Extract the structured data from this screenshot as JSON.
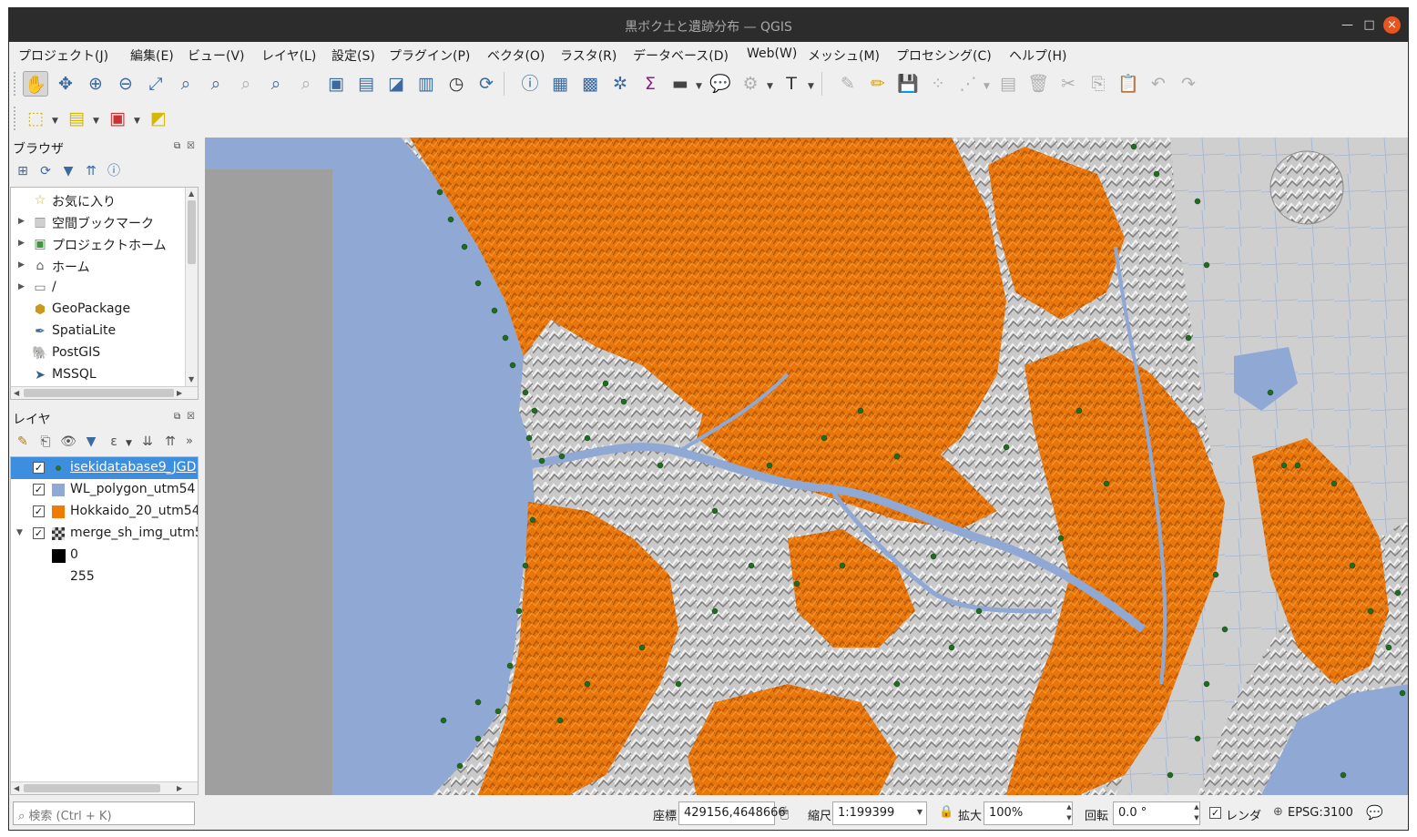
{
  "window": {
    "title": "黒ボク土と遺跡分布 — QGIS"
  },
  "menu": [
    "プロジェクト(J)",
    "編集(E)",
    "ビュー(V)",
    "レイヤ(L)",
    "設定(S)",
    "プラグイン(P)",
    "ベクタ(O)",
    "ラスタ(R)",
    "データベース(D)",
    "Web(W)",
    "メッシュ(M)",
    "プロセシング(C)",
    "ヘルプ(H)"
  ],
  "toolbar1_icons": [
    "pan-icon",
    "pan-to-selection-icon",
    "zoom-in-icon",
    "zoom-out-icon",
    "zoom-full-icon",
    "zoom-to-selection-icon",
    "zoom-to-layer-icon",
    "zoom-native-icon",
    "zoom-last-icon",
    "zoom-next-icon",
    "new-bookmark-icon",
    "show-bookmarks-icon",
    "new-map-view-icon",
    "new-3d-view-icon",
    "temporal-controller-icon",
    "refresh-icon",
    "identify-icon",
    "attribute-table-icon",
    "field-calculator-icon",
    "statistics-icon",
    "sigma-icon",
    "measure-icon",
    "map-tips-icon",
    "locator-icon",
    "text-annotation-icon",
    "digitize-icon",
    "edit-pencil-icon",
    "save-edits-icon",
    "add-feature-icon",
    "vertex-tool-icon",
    "modify-attributes-icon",
    "delete-selected-icon",
    "cut-features-icon",
    "copy-features-icon",
    "paste-features-icon",
    "undo-icon",
    "redo-icon"
  ],
  "toolbar2_icons": [
    "select-features-icon",
    "select-by-value-icon",
    "deselect-all-icon",
    "select-location-icon"
  ],
  "browser": {
    "title": "ブラウザ",
    "items": [
      {
        "label": "お気に入り",
        "icon": "star-icon"
      },
      {
        "label": "空間ブックマーク",
        "icon": "bookmark-icon"
      },
      {
        "label": "プロジェクトホーム",
        "icon": "project-home-icon"
      },
      {
        "label": "ホーム",
        "icon": "home-icon"
      },
      {
        "label": "/",
        "icon": "folder-icon"
      },
      {
        "label": "GeoPackage",
        "icon": "geopackage-icon"
      },
      {
        "label": "SpatiaLite",
        "icon": "spatialite-icon"
      },
      {
        "label": "PostGIS",
        "icon": "postgis-icon"
      },
      {
        "label": "MSSQL",
        "icon": "mssql-icon"
      }
    ]
  },
  "layers": {
    "title": "レイヤ",
    "items": [
      {
        "label": "isekidatabase9_JGD",
        "selected": true,
        "color": "#2e6b2e"
      },
      {
        "label": "WL_polygon_utm54",
        "selected": false,
        "color": "#8fa8d4"
      },
      {
        "label": "Hokkaido_20_utm54",
        "selected": false,
        "color": "#f07b00"
      },
      {
        "label": "merge_sh_img_utm5",
        "selected": false,
        "color": "#808080"
      }
    ],
    "legend": [
      "0",
      "255"
    ]
  },
  "status": {
    "search_placeholder": "検索 (Ctrl + K)",
    "coord_label": "座標",
    "coord_value": "429156,4648666",
    "scale_label": "縮尺",
    "scale_value": "1:199399",
    "magnifier_label": "拡大",
    "magnifier_value": "100%",
    "rotation_label": "回転",
    "rotation_value": "0.0 °",
    "render_label": "レンダ",
    "crs": "EPSG:3100"
  },
  "colors": {
    "water": "#8fa8d4",
    "soil": "#f07b00",
    "sites": "#1f6b1f",
    "accent": "#3d8ede"
  }
}
